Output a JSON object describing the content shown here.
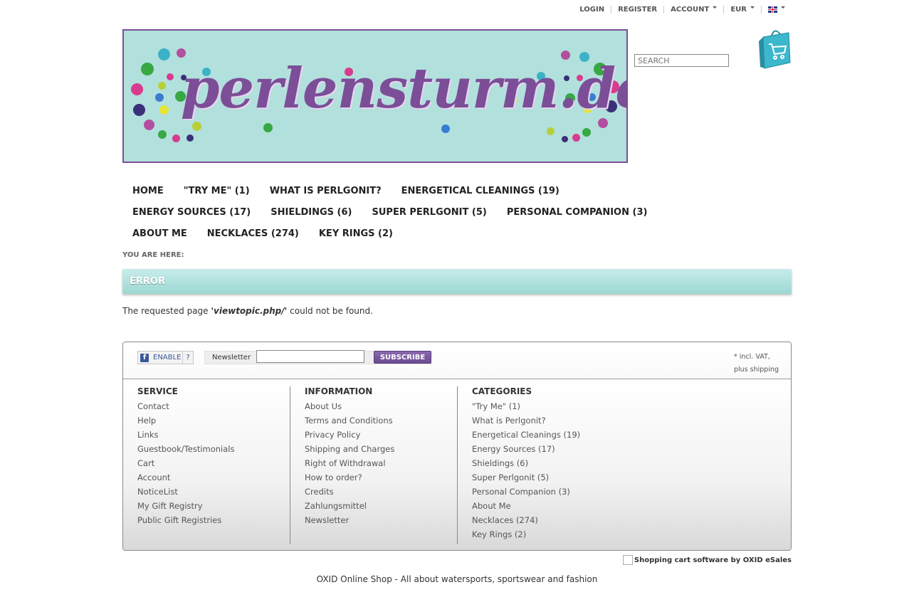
{
  "topbar": {
    "login": "LOGIN",
    "register": "REGISTER",
    "account": "ACCOUNT",
    "currency": "EUR"
  },
  "banner": {
    "logo_text": "perlensturm.de"
  },
  "search": {
    "placeholder": "SEARCH"
  },
  "nav": {
    "row1": [
      "HOME",
      "\"TRY ME\" (1)",
      "WHAT IS PERLGONIT?",
      "ENERGETICAL CLEANINGS (19)"
    ],
    "row2": [
      "ENERGY SOURCES (17)",
      "SHIELDINGS (6)",
      "SUPER PERLGONIT (5)",
      "PERSONAL COMPANION (3)"
    ],
    "row3": [
      "ABOUT ME",
      "NECKLACES (274)",
      "KEY RINGS (2)"
    ]
  },
  "breadcrumb": "YOU ARE HERE:",
  "page_title": "ERROR",
  "error": {
    "before": "The requested page ",
    "page": "'viewtopic.php/'",
    "after": " could not be found."
  },
  "footer_bar": {
    "facebook_enable": "ENABLE",
    "facebook_help": "?",
    "newsletter_label": "Newsletter",
    "subscribe": "SUBSCRIBE",
    "vat_note": "* incl. VAT, plus shipping"
  },
  "service": {
    "title": "SERVICE",
    "items": [
      "Contact",
      "Help",
      "Links",
      "Guestbook/Testimonials",
      "Cart",
      "Account",
      "NoticeList",
      "My Gift Registry",
      "Public Gift Registries"
    ]
  },
  "information": {
    "title": "INFORMATION",
    "items": [
      "About Us",
      "Terms and Conditions",
      "Privacy Policy",
      "Shipping and Charges",
      "Right of Withdrawal",
      "How to order?",
      "Credits",
      "Zahlungsmittel",
      "Newsletter"
    ]
  },
  "categories": {
    "title": "CATEGORIES",
    "items": [
      "\"Try Me\" (1)",
      "What is Perlgonit?",
      "Energetical Cleanings (19)",
      "Energy Sources (17)",
      "Shieldings (6)",
      "Super Perlgonit (5)",
      "Personal Companion (3)",
      "About Me",
      "Necklaces (274)",
      "Key Rings (2)"
    ]
  },
  "oxid_badge": "Shopping cart software by OXID eSales",
  "bottom_text": "OXID Online Shop - All about watersports, sportswear and fashion",
  "colors": {
    "accent": "#7b4e97",
    "banner_bg": "#b2e0dc",
    "title_bar": "#9dd8d3"
  }
}
